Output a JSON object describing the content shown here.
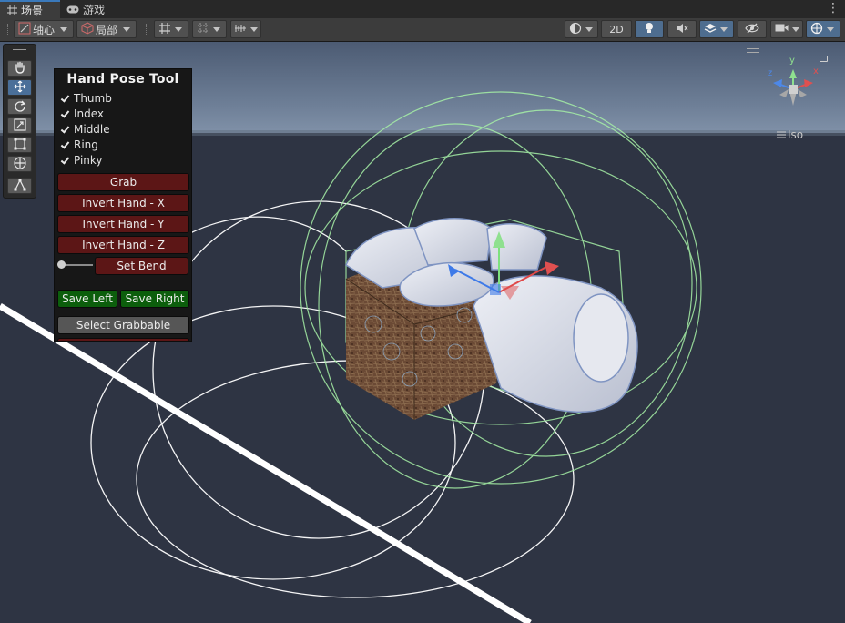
{
  "tabs": [
    {
      "label": "场景",
      "icon": "grid-icon",
      "active": true
    },
    {
      "label": "游戏",
      "icon": "gamepad-icon",
      "active": false
    }
  ],
  "toolbar": {
    "pivot_label": "轴心",
    "space_label": "局部",
    "mode_2d_label": "2D"
  },
  "gizmo": {
    "projection_label": "Iso",
    "axes": {
      "x": "x",
      "y": "y",
      "z": "z"
    }
  },
  "panel": {
    "title": "Hand Pose Tool",
    "fingers": [
      {
        "label": "Thumb",
        "checked": true
      },
      {
        "label": "Index",
        "checked": true
      },
      {
        "label": "Middle",
        "checked": true
      },
      {
        "label": "Ring",
        "checked": true
      },
      {
        "label": "Pinky",
        "checked": true
      }
    ],
    "grab_label": "Grab",
    "invert_x_label": "Invert Hand - X",
    "invert_y_label": "Invert Hand - Y",
    "invert_z_label": "Invert Hand - Z",
    "set_bend_label": "Set Bend",
    "bend_value": 0,
    "save_left_label": "Save Left",
    "save_right_label": "Save Right",
    "select_grabbable_label": "Select Grabbable"
  },
  "colors": {
    "accent": "#3a79bb",
    "panel_red": "#5c1616",
    "panel_green": "#0c5e0c",
    "sky_top": "#4b5b73",
    "ground": "#2d3342"
  }
}
